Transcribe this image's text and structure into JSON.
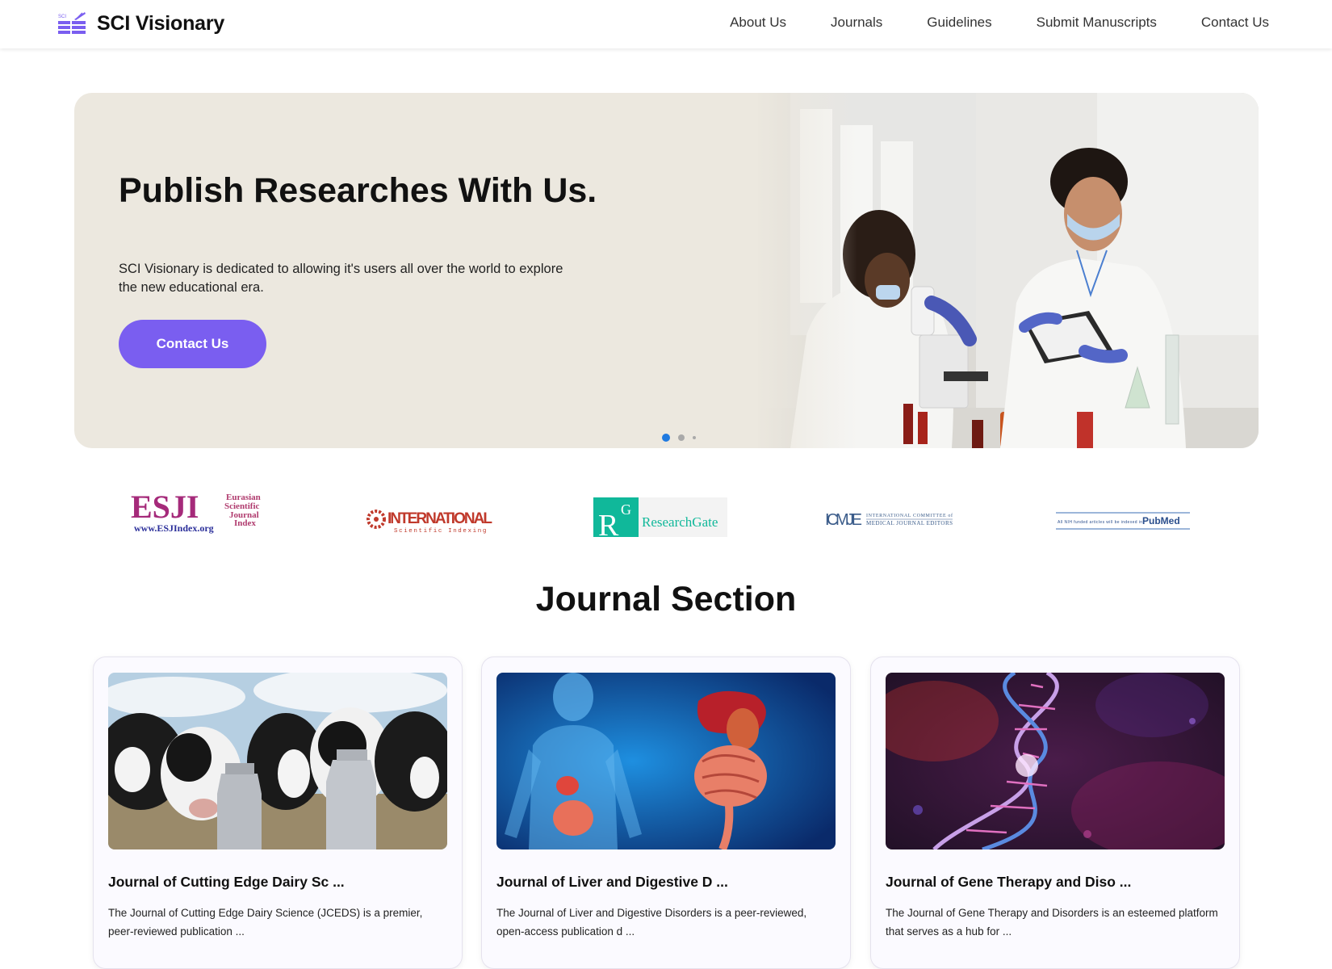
{
  "header": {
    "brand": "SCI Visionary",
    "brand_mini": "SCI",
    "nav": [
      "About Us",
      "Journals",
      "Guidelines",
      "Submit Manuscripts",
      "Contact Us"
    ]
  },
  "hero": {
    "title": "Publish Researches With Us.",
    "description": "SCI Visionary is dedicated to allowing it's users all over the world to explore the new educational era.",
    "cta": "Contact Us",
    "slides": 3,
    "active_slide": 1
  },
  "indexing_logos": {
    "esji": {
      "main": "ESJI",
      "side_1": "Eurasian",
      "side_2": "Scientific",
      "side_3": "Journal",
      "side_4": "Index",
      "url": "www.ESJIndex.org"
    },
    "isi": {
      "main": "INTERNATIONAL",
      "sub": "Scientific Indexing"
    },
    "researchgate": {
      "badge": "R",
      "badge_sup": "G",
      "name": "ResearchGate"
    },
    "icmje": {
      "abbr": "ICMJE",
      "line1": "INTERNATIONAL COMMITTEE of",
      "line2": "MEDICAL JOURNAL EDITORS"
    },
    "pubmed": {
      "note": "All NIH funded articles will be indexed in",
      "name": "PubMed"
    }
  },
  "journals": {
    "title": "Journal Section",
    "cards": [
      {
        "title": "Journal of Cutting Edge Dairy Sc ...",
        "description": "The Journal of Cutting Edge Dairy Science (JCEDS) is a premier, peer-reviewed publication ..."
      },
      {
        "title": "Journal of Liver and Digestive D ...",
        "description": "The Journal of Liver and Digestive Disorders is a peer-reviewed, open-access publication d ..."
      },
      {
        "title": "Journal of Gene Therapy and Diso ...",
        "description": "The Journal of Gene Therapy and Disorders is an esteemed platform that serves as a hub for ..."
      }
    ]
  },
  "colors": {
    "accent": "#7a5ef0",
    "hero_bg": "#ece8df",
    "dot_active": "#1f7ae0"
  }
}
